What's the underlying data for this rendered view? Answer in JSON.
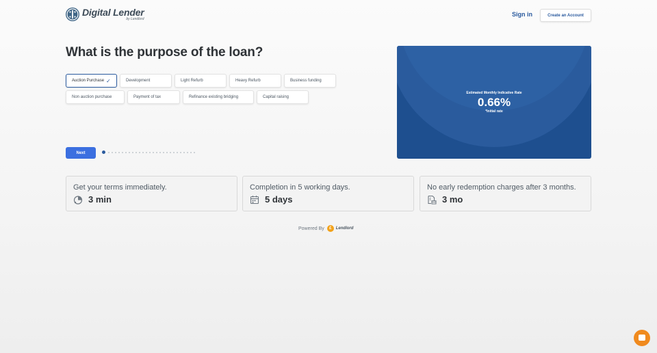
{
  "header": {
    "brand_title": "Digital Lender",
    "brand_sub": "by Lendlord",
    "sign_in": "Sign in",
    "create_account": "Create an Account"
  },
  "main": {
    "title": "What is the purpose of the loan?",
    "options": [
      {
        "label": "Auction Purchase",
        "selected": true
      },
      {
        "label": "Development",
        "selected": false
      },
      {
        "label": "Light Refurb",
        "selected": false
      },
      {
        "label": "Heavy Refurb",
        "selected": false
      },
      {
        "label": "Business funding",
        "selected": false
      },
      {
        "label": "Non auction purchase",
        "selected": false
      },
      {
        "label": "Payment of tax",
        "selected": false
      },
      {
        "label": "Refinance existing bridging",
        "selected": false
      },
      {
        "label": "Capital raising",
        "selected": false
      }
    ],
    "check_glyph": "✓",
    "next_label": "Next",
    "progress": {
      "current_step": 1,
      "total_steps": 27
    }
  },
  "rate_card": {
    "label": "Estimated Monthly Indicative Rate",
    "value": "0.66%",
    "note": "*Initial rate"
  },
  "features": [
    {
      "title": "Get your terms immediately.",
      "value": "3 min",
      "icon": "timer-icon"
    },
    {
      "title": "Completion in 5 working days.",
      "value": "5 days",
      "icon": "calendar-icon"
    },
    {
      "title": "No early redemption charges after 3 months.",
      "value": "3 mo",
      "icon": "document-pound-icon"
    }
  ],
  "footer": {
    "powered_by": "Powered By",
    "brand_mark": "£",
    "brand_name": "Lendlord"
  },
  "colors": {
    "accent": "#2a5a9e",
    "next_button": "#3b6fe0",
    "rate_card": "#1e4f8f",
    "chat": "#f08a1e"
  }
}
